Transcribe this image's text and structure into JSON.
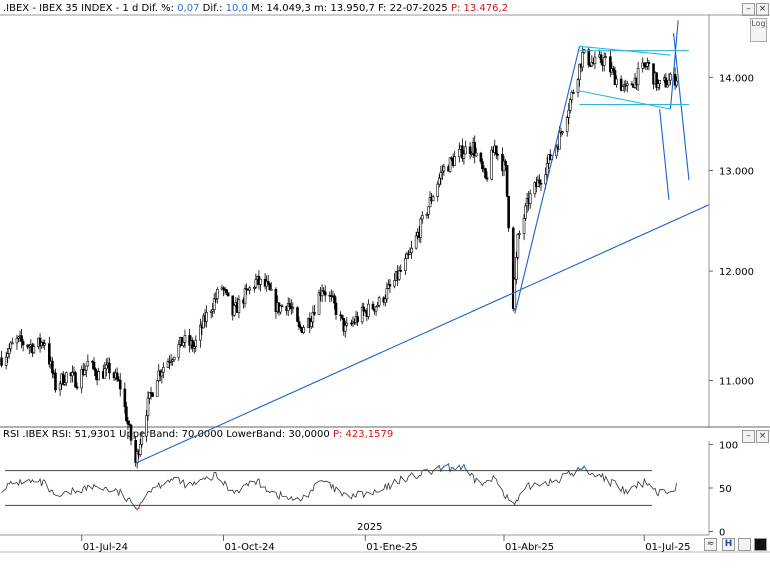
{
  "header": {
    "symbol": ".IBEX - IBEX 35 INDEX - 1 d",
    "dif_pct_label": "Dif. %:",
    "dif_pct": "0,07",
    "dif_label": "Dif.:",
    "dif": "10,0",
    "max_label": "M:",
    "max": "14.049,3",
    "min_label": "m:",
    "min": "13.950,7",
    "date_label": "F:",
    "date": "22-07-2025",
    "p_label": "P:",
    "p": "13.476,2"
  },
  "rsi_header": {
    "name": "RSI .IBEX",
    "rsi_label": "RSI:",
    "rsi": "51,9301",
    "upper_label": "UpperBand:",
    "upper": "70,0000",
    "lower_label": "LowerBand:",
    "lower": "30,0000",
    "p_label": "P:",
    "p": "423,1579"
  },
  "buttons": {
    "log": "Log",
    "wave": "≈",
    "save": "H"
  },
  "colors": {
    "candle": "#000000",
    "trendline": "#1a63c9",
    "channel": "#2bb6d8",
    "rsi_line": "#333333",
    "rsi_over": "#3a7bd5",
    "rsi_under": "#d04040",
    "price_label": "#d01818",
    "value_label": "#2a6fd6"
  },
  "chart_data": [
    {
      "type": "candlestick",
      "title": "IBEX 35 INDEX - 1 d",
      "y_axis_ticks": [
        "14.000",
        "13.000",
        "12.000",
        "11.000"
      ],
      "ylim": [
        10600,
        14700
      ],
      "scale": "log",
      "x_axis_ticks": [
        "01-Jul-24",
        "01-Oct-24",
        "01-Ene-25",
        "01-Abr-25",
        "01-Jul-25"
      ],
      "year_marker": "2025",
      "xlim": [
        "2024-05-09",
        "2025-08-12"
      ],
      "path_points": [
        [
          "2024-05-10",
          11200
        ],
        [
          "2024-05-20",
          11350
        ],
        [
          "2024-05-31",
          11300
        ],
        [
          "2024-06-07",
          11350
        ],
        [
          "2024-06-14",
          10950
        ],
        [
          "2024-06-21",
          11050
        ],
        [
          "2024-06-28",
          11000
        ],
        [
          "2024-07-05",
          11150
        ],
        [
          "2024-07-12",
          11050
        ],
        [
          "2024-07-19",
          11100
        ],
        [
          "2024-07-26",
          10950
        ],
        [
          "2024-08-05",
          10300
        ],
        [
          "2024-08-12",
          10750
        ],
        [
          "2024-08-19",
          11050
        ],
        [
          "2024-08-27",
          11200
        ],
        [
          "2024-09-05",
          11350
        ],
        [
          "2024-09-12",
          11300
        ],
        [
          "2024-09-19",
          11550
        ],
        [
          "2024-09-26",
          11750
        ],
        [
          "2024-09-30",
          11850
        ],
        [
          "2024-10-07",
          11600
        ],
        [
          "2024-10-14",
          11750
        ],
        [
          "2024-10-22",
          11900
        ],
        [
          "2024-10-29",
          11850
        ],
        [
          "2024-11-05",
          11650
        ],
        [
          "2024-11-12",
          11700
        ],
        [
          "2024-11-19",
          11450
        ],
        [
          "2024-11-26",
          11550
        ],
        [
          "2024-12-04",
          11850
        ],
        [
          "2024-12-11",
          11700
        ],
        [
          "2024-12-19",
          11450
        ],
        [
          "2024-12-30",
          11600
        ],
        [
          "2025-01-10",
          11700
        ],
        [
          "2025-01-20",
          11900
        ],
        [
          "2025-01-30",
          12150
        ],
        [
          "2025-02-10",
          12600
        ],
        [
          "2025-02-20",
          13000
        ],
        [
          "2025-03-05",
          13200
        ],
        [
          "2025-03-12",
          13250
        ],
        [
          "2025-03-20",
          12900
        ],
        [
          "2025-03-26",
          13250
        ],
        [
          "2025-04-02",
          13000
        ],
        [
          "2025-04-07",
          11700
        ],
        [
          "2025-04-10",
          12300
        ],
        [
          "2025-04-17",
          12700
        ],
        [
          "2025-04-24",
          12900
        ],
        [
          "2025-05-06",
          13300
        ],
        [
          "2025-05-15",
          13800
        ],
        [
          "2025-05-22",
          14250
        ],
        [
          "2025-05-29",
          14150
        ],
        [
          "2025-06-05",
          14200
        ],
        [
          "2025-06-12",
          14000
        ],
        [
          "2025-06-19",
          13850
        ],
        [
          "2025-06-26",
          14000
        ],
        [
          "2025-07-03",
          14150
        ],
        [
          "2025-07-10",
          13900
        ],
        [
          "2025-07-16",
          13950
        ],
        [
          "2025-07-22",
          14000
        ]
      ],
      "trendlines": [
        {
          "kind": "support",
          "from": [
            "2024-08-05",
            10300
          ],
          "to": [
            "2025-08-12",
            12650
          ]
        },
        {
          "kind": "impulse",
          "from": [
            "2025-04-08",
            11600
          ],
          "to": [
            "2025-05-20",
            14350
          ]
        },
        {
          "kind": "impulse",
          "from": [
            "2025-07-18",
            13650
          ],
          "to": [
            "2025-07-23",
            14650
          ]
        },
        {
          "kind": "projection",
          "from": [
            "2025-07-20",
            14500
          ],
          "to": [
            "2025-07-30",
            12900
          ]
        },
        {
          "kind": "projection",
          "from": [
            "2025-07-11",
            13650
          ],
          "to": [
            "2025-07-17",
            12700
          ]
        },
        {
          "kind": "channel",
          "from": [
            "2025-05-20",
            14350
          ],
          "to": [
            "2025-07-18",
            14250
          ]
        },
        {
          "kind": "channel",
          "from": [
            "2025-05-20",
            13850
          ],
          "to": [
            "2025-07-18",
            13650
          ]
        },
        {
          "kind": "level",
          "from": [
            "2025-05-20",
            14300
          ],
          "to": [
            "2025-07-30",
            14300
          ]
        },
        {
          "kind": "level",
          "from": [
            "2025-05-20",
            13700
          ],
          "to": [
            "2025-07-30",
            13700
          ]
        }
      ]
    },
    {
      "type": "line",
      "title": "RSI .IBEX",
      "y_axis_ticks": [
        "100",
        "50",
        "0"
      ],
      "ylim": [
        -4,
        104
      ],
      "bands": [
        70,
        30
      ],
      "path_points": [
        [
          "2024-05-10",
          50
        ],
        [
          "2024-05-24",
          58
        ],
        [
          "2024-06-07",
          55
        ],
        [
          "2024-06-14",
          38
        ],
        [
          "2024-06-28",
          48
        ],
        [
          "2024-07-12",
          52
        ],
        [
          "2024-07-26",
          44
        ],
        [
          "2024-08-05",
          27
        ],
        [
          "2024-08-14",
          48
        ],
        [
          "2024-08-27",
          60
        ],
        [
          "2024-09-10",
          53
        ],
        [
          "2024-09-26",
          64
        ],
        [
          "2024-10-07",
          46
        ],
        [
          "2024-10-22",
          58
        ],
        [
          "2024-11-05",
          42
        ],
        [
          "2024-11-19",
          35
        ],
        [
          "2024-12-04",
          58
        ],
        [
          "2024-12-19",
          40
        ],
        [
          "2025-01-10",
          45
        ],
        [
          "2025-01-24",
          60
        ],
        [
          "2025-02-10",
          67
        ],
        [
          "2025-02-20",
          72
        ],
        [
          "2025-03-05",
          74
        ],
        [
          "2025-03-12",
          60
        ],
        [
          "2025-03-20",
          55
        ],
        [
          "2025-03-26",
          62
        ],
        [
          "2025-04-07",
          29
        ],
        [
          "2025-04-17",
          52
        ],
        [
          "2025-05-06",
          60
        ],
        [
          "2025-05-22",
          72
        ],
        [
          "2025-06-05",
          62
        ],
        [
          "2025-06-19",
          45
        ],
        [
          "2025-07-03",
          58
        ],
        [
          "2025-07-10",
          44
        ],
        [
          "2025-07-22",
          52
        ]
      ]
    }
  ]
}
